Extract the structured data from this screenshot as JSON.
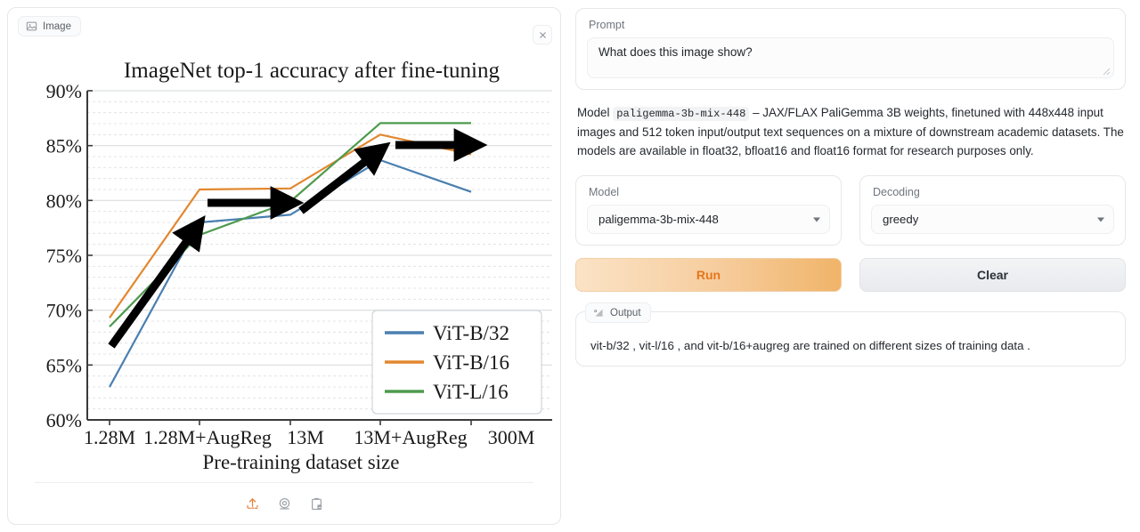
{
  "image_panel": {
    "tab_label": "Image",
    "tab_icon": "image-icon",
    "close_icon": "close-icon",
    "tools": [
      {
        "name": "upload-icon",
        "label": "Upload",
        "color": "#e8803a"
      },
      {
        "name": "webcam-icon",
        "label": "Webcam",
        "color": "#9aa0a8"
      },
      {
        "name": "paste-clipboard-image-icon",
        "label": "Paste from clipboard",
        "color": "#9aa0a8"
      }
    ]
  },
  "chart_data": {
    "type": "line",
    "title": "ImageNet top-1 accuracy after fine-tuning",
    "xlabel": "Pre-training dataset size",
    "ylabel": "",
    "categories": [
      "1.28M",
      "1.28M+AugReg",
      "13M",
      "13M+AugReg",
      "300M"
    ],
    "ylim": [
      60,
      90
    ],
    "yticks": [
      60,
      65,
      70,
      75,
      80,
      85,
      90
    ],
    "ytick_labels": [
      "60%",
      "65%",
      "70%",
      "75%",
      "80%",
      "85%",
      "90%"
    ],
    "grid": true,
    "legend_position": "lower right",
    "series": [
      {
        "name": "ViT-B/32",
        "color": "#4a7fb0",
        "values": [
          63.0,
          78.0,
          78.7,
          83.7,
          80.8
        ]
      },
      {
        "name": "ViT-B/16",
        "color": "#e2882f",
        "values": [
          69.3,
          81.0,
          81.1,
          86.0,
          84.2
        ]
      },
      {
        "name": "ViT-L/16",
        "color": "#4e9a4e",
        "values": [
          68.5,
          76.9,
          79.9,
          87.1,
          87.1
        ]
      }
    ],
    "annotations": [
      {
        "type": "arrow",
        "from": [
          "1.28M",
          66.7
        ],
        "to": [
          "1.28M+AugReg",
          79.6
        ],
        "color": "#000000"
      },
      {
        "type": "arrow",
        "from": [
          "1.28M+AugReg",
          79.6
        ],
        "to": [
          "13M",
          79.9
        ],
        "color": "#000000"
      },
      {
        "type": "arrow",
        "from": [
          "13M",
          79.7
        ],
        "to": [
          "13M+AugReg",
          84.9
        ],
        "color": "#000000"
      },
      {
        "type": "arrow",
        "from": [
          "13M+AugReg",
          84.9
        ],
        "to": [
          "300M",
          84.9
        ],
        "color": "#000000"
      }
    ]
  },
  "prompt": {
    "label": "Prompt",
    "value": "What does this image show?",
    "placeholder": ""
  },
  "model_description": {
    "prefix": "Model ",
    "code": "paligemma-3b-mix-448",
    "body": " – JAX/FLAX PaliGemma 3B weights, finetuned with 448x448 input images and 512 token input/output text sequences on a mixture of downstream academic datasets. The models are available in float32, bfloat16 and float16 format for research purposes only."
  },
  "model_select": {
    "label": "Model",
    "value": "paligemma-3b-mix-448"
  },
  "decoding_select": {
    "label": "Decoding",
    "value": "greedy"
  },
  "buttons": {
    "run_label": "Run",
    "clear_label": "Clear"
  },
  "output": {
    "tab_label": "Output",
    "tab_icon": "text-output-icon",
    "text": "vit-b/32 , vit-l/16 , and vit-b/16+augreg are trained on different sizes of training data ."
  },
  "colors": {
    "accent": "#e4761d",
    "panel_border": "#e6e7ea",
    "text": "#24282e"
  }
}
